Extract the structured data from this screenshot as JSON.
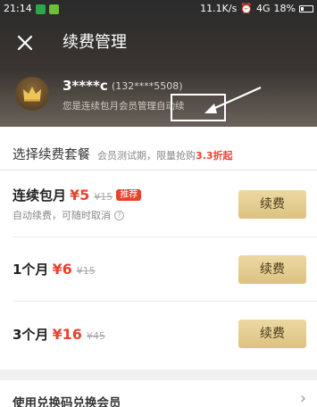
{
  "status_bar": {
    "time": "21:14",
    "speed": "11.1K/s",
    "network": "4G",
    "battery": "18%"
  },
  "nav": {
    "close_icon": "close-icon",
    "title": "续费管理"
  },
  "user": {
    "name": "3****c",
    "phone": "(132****5508)",
    "description": "您是连续包月会员",
    "manage_link": "管理自动续"
  },
  "section": {
    "title": "选择续费套餐",
    "subtitle": "会员测试期，限量抢购",
    "promo": "3.3折起"
  },
  "plans": [
    {
      "name": "连续包月",
      "price": "¥5",
      "original_price": "¥15",
      "badge": "推荐",
      "note": "自动续费，可随时取消",
      "button": "续费"
    },
    {
      "name": "1个月",
      "price": "¥6",
      "original_price": "¥15",
      "button": "续费"
    },
    {
      "name": "3个月",
      "price": "¥16",
      "original_price": "¥45",
      "button": "续费"
    }
  ],
  "redeem": {
    "label": "使用兑换码兑换会员",
    "chevron": "›"
  },
  "colors": {
    "accent_red": "#e8422f",
    "gold_button": "#e5d08f",
    "header_dark": "#2b2b2b"
  }
}
